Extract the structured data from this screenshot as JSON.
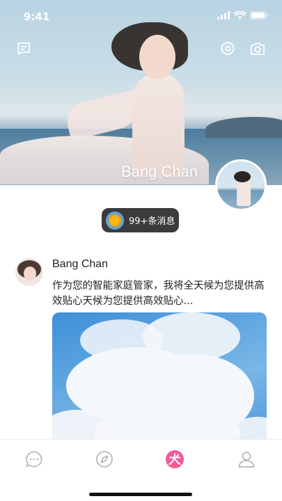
{
  "status_bar": {
    "time": "9:41"
  },
  "profile": {
    "name": "Bang Chan"
  },
  "notification": {
    "text": "99+条消息"
  },
  "post": {
    "author": "Bang Chan",
    "text": "作为您的智能家庭管家，我将全天候为您提供高效贴心天候为您提供高效贴心..."
  },
  "icons": {
    "top_left": "message-icon",
    "top_right": [
      "settings-icon",
      "camera-icon"
    ],
    "tabs": [
      "chat-icon",
      "discover-icon",
      "home-logo-icon",
      "profile-icon"
    ]
  },
  "colors": {
    "accent": "#f25a9a",
    "tab_inactive": "#b8b8b8",
    "pill_bg": "#3b3b3d"
  }
}
